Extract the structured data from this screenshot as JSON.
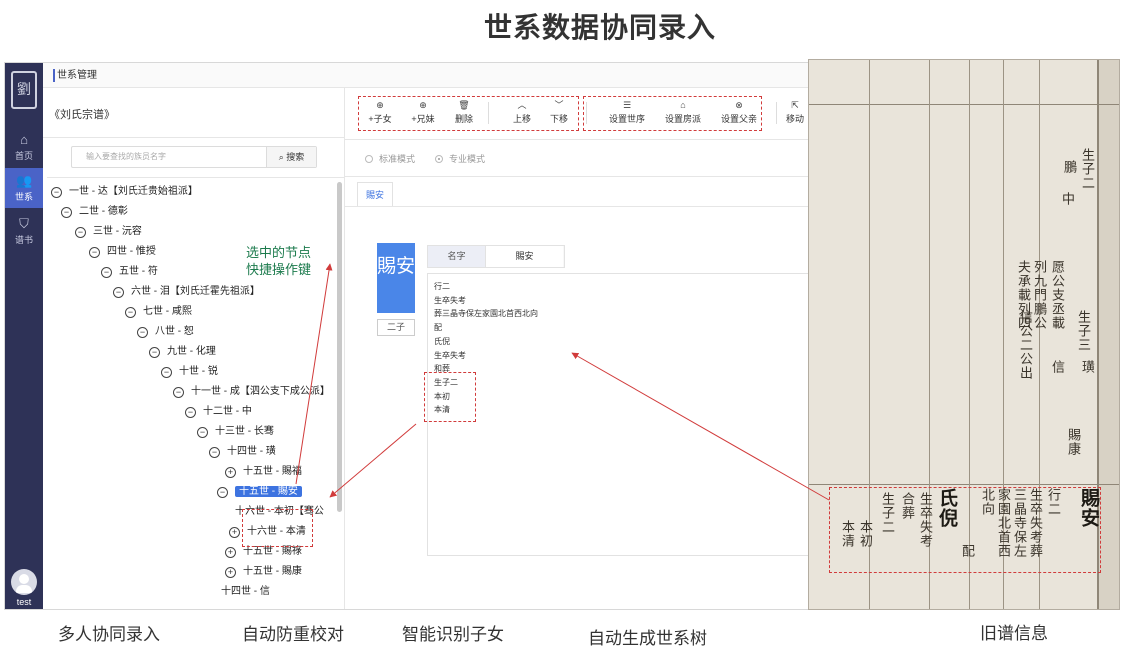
{
  "banner": {
    "title": "世系数据协同录入"
  },
  "app": {
    "logo": "劉",
    "sidebar": [
      {
        "label": "首页",
        "icon": "home-icon",
        "glyph": "⌂"
      },
      {
        "label": "世系",
        "icon": "users-icon",
        "glyph": "👥"
      },
      {
        "label": "谱书",
        "icon": "shield-icon",
        "glyph": "⛉"
      }
    ],
    "user": "test",
    "breadcrumb": "世系管理",
    "book_title": "《刘氏宗谱》",
    "search": {
      "placeholder": "输入要查找的族员名字",
      "button": "搜索",
      "icon": "search-icon"
    },
    "tree": [
      {
        "label": "一世 - 达【刘氏迁贵始祖派】",
        "toggle": "⊖"
      },
      {
        "label": "二世 - 德彰",
        "toggle": "⊖"
      },
      {
        "label": "三世 - 沅容",
        "toggle": "⊖"
      },
      {
        "label": "四世 - 惟授",
        "toggle": "⊖"
      },
      {
        "label": "五世 - 符",
        "toggle": "⊖"
      },
      {
        "label": "六世 - 泪【刘氏迁霍先祖派】",
        "toggle": "⊖"
      },
      {
        "label": "七世 - 咸熙",
        "toggle": "⊖"
      },
      {
        "label": "八世 - 恕",
        "toggle": "⊖"
      },
      {
        "label": "九世 - 化理",
        "toggle": "⊖"
      },
      {
        "label": "十世 - 锐",
        "toggle": "⊖"
      },
      {
        "label": "十一世 - 成【泗公支下成公派】",
        "toggle": "⊖"
      },
      {
        "label": "十二世 - 中",
        "toggle": "⊖"
      },
      {
        "label": "十三世 - 长骞",
        "toggle": "⊖"
      },
      {
        "label": "十四世 - 璜",
        "toggle": "⊖"
      },
      {
        "label": "十五世 - 賜福",
        "toggle": "⊕"
      },
      {
        "label": "十五世 - 賜安",
        "toggle": "⊖"
      },
      {
        "label": "十六世 - 本初【骞公",
        "toggle": ""
      },
      {
        "label": "十六世 - 本清",
        "toggle": "⊕"
      },
      {
        "label": "十五世 - 賜祿",
        "toggle": "⊕"
      },
      {
        "label": "十五世 - 賜康",
        "toggle": "⊕"
      },
      {
        "label": "十四世 - 信",
        "toggle": ""
      }
    ],
    "toolbar": [
      {
        "label": "+子女",
        "icon": "add-child-icon",
        "glyph": "⊕"
      },
      {
        "label": "+兄妹",
        "icon": "add-sibling-icon",
        "glyph": "⊕"
      },
      {
        "label": "删除",
        "icon": "trash-icon",
        "glyph": "🗑"
      },
      {
        "label": "上移",
        "icon": "chevron-up-icon",
        "glyph": "︿"
      },
      {
        "label": "下移",
        "icon": "chevron-down-icon",
        "glyph": "﹀"
      },
      {
        "label": "设置世序",
        "icon": "sliders-icon",
        "glyph": "☰"
      },
      {
        "label": "设置房派",
        "icon": "house-icon",
        "glyph": "⌂"
      },
      {
        "label": "设置父亲",
        "icon": "link-icon",
        "glyph": "⊗"
      },
      {
        "label": "移动",
        "icon": "move-icon",
        "glyph": "⇱"
      }
    ],
    "modes": [
      {
        "label": "标准模式",
        "checked": false
      },
      {
        "label": "专业模式",
        "checked": true
      }
    ],
    "active_tab": "賜安",
    "person": {
      "name": "賜安",
      "rank": "二子",
      "field_tab": "名字",
      "field_value": "賜安"
    },
    "text_lines": [
      "行二",
      "生卒失考",
      "葬三晶寺保左家園北首西北向",
      "配",
      "氏倪",
      "生卒失考",
      "和葬",
      "生子二",
      "本初",
      "本清"
    ]
  },
  "scan": {
    "columns": [
      {
        "text": "生子二",
        "big": false
      },
      {
        "text": "鵬",
        "big": false
      },
      {
        "text": "中",
        "big": false
      },
      {
        "text": "愿公支丞載",
        "big": false
      },
      {
        "text": "列九門鵬公",
        "big": false
      },
      {
        "text": "夫承載列四",
        "big": false
      },
      {
        "text": "生子三",
        "big": false
      },
      {
        "text": "信公二公出",
        "big": false
      },
      {
        "text": "信",
        "big": false
      },
      {
        "text": "璜",
        "big": false
      },
      {
        "text": "賜康",
        "big": false
      },
      {
        "text": "賜安",
        "big": true
      },
      {
        "text": "行二",
        "big": false
      },
      {
        "text": "生卒失考葬",
        "big": false
      },
      {
        "text": "三晶寺保左",
        "big": false
      },
      {
        "text": "家園北首西",
        "big": false
      },
      {
        "text": "北向",
        "big": false
      },
      {
        "text": "氏倪",
        "big": true
      },
      {
        "text": "生卒失考",
        "big": false
      },
      {
        "text": "合葬",
        "big": false
      },
      {
        "text": "生子二",
        "big": false
      },
      {
        "text": "本初",
        "big": false
      },
      {
        "text": "本清",
        "big": false
      },
      {
        "text": "配",
        "big": false
      }
    ]
  },
  "annotations": {
    "shortcut_note": [
      "选中的节点",
      "快捷操作键"
    ]
  },
  "captions": [
    "多人协同录入",
    "自动防重校对",
    "智能识别子女",
    "自动生成世系树",
    "旧谱信息"
  ]
}
